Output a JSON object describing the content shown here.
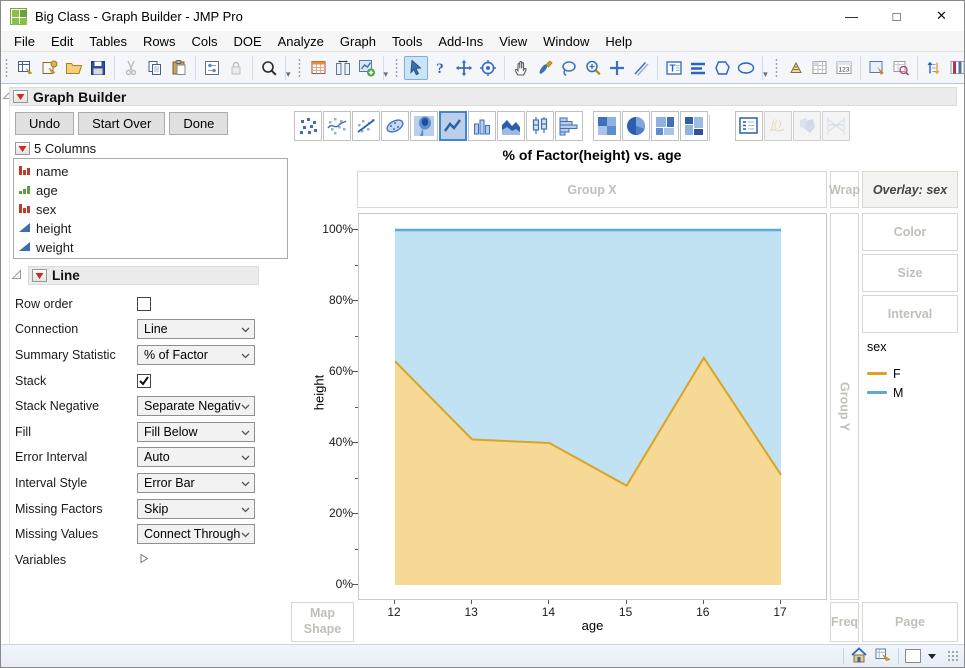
{
  "window": {
    "title": "Big Class - Graph Builder - JMP Pro",
    "controls": [
      {
        "name": "minimize-button",
        "glyph": "—"
      },
      {
        "name": "maximize-button",
        "glyph": "□"
      },
      {
        "name": "close-button",
        "glyph": "✕"
      }
    ]
  },
  "menu": {
    "items": [
      "File",
      "Edit",
      "Tables",
      "Rows",
      "Cols",
      "DOE",
      "Analyze",
      "Graph",
      "Tools",
      "Add-Ins",
      "View",
      "Window",
      "Help"
    ]
  },
  "toolbar": {
    "sections": [
      {
        "groups": [
          {
            "icons": [
              {
                "name": "new-data-table-icon"
              },
              {
                "name": "new-journal-icon"
              },
              {
                "name": "open-icon"
              },
              {
                "name": "save-icon"
              }
            ]
          },
          {
            "icons": [
              {
                "name": "cut-icon",
                "disabled": true
              },
              {
                "name": "copy-icon"
              },
              {
                "name": "paste-icon"
              }
            ]
          },
          {
            "icons": [
              {
                "name": "preferences-icon"
              },
              {
                "name": "lock-icon",
                "disabled": true
              }
            ]
          },
          {
            "icons": [
              {
                "name": "search-icon"
              }
            ]
          }
        ]
      },
      {
        "groups": [
          {
            "icons": [
              {
                "name": "data-table-icon"
              },
              {
                "name": "column-viewer-icon"
              },
              {
                "name": "new-graph-icon"
              }
            ]
          }
        ]
      },
      {
        "groups": [
          {
            "icons": [
              {
                "name": "arrow-cursor-icon",
                "selected": true
              },
              {
                "name": "help-icon"
              },
              {
                "name": "move-tool-icon"
              },
              {
                "name": "selection-target-icon"
              }
            ]
          },
          {
            "icons": [
              {
                "name": "grabber-hand-icon"
              },
              {
                "name": "brush-icon"
              },
              {
                "name": "lasso-icon"
              },
              {
                "name": "magnifier-zoom-icon"
              },
              {
                "name": "crosshair-icon"
              },
              {
                "name": "line-draw-icon"
              }
            ]
          },
          {
            "icons": [
              {
                "name": "text-annotation-icon"
              },
              {
                "name": "thick-lines-icon"
              },
              {
                "name": "polygon-icon"
              },
              {
                "name": "oval-icon"
              }
            ]
          }
        ]
      },
      {
        "groups": [
          {
            "icons": [
              {
                "name": "sort-pyramid-icon"
              },
              {
                "name": "grid-cells-icon"
              },
              {
                "name": "value-labels-icon"
              }
            ]
          },
          {
            "icons": [
              {
                "name": "zoom-window-icon"
              },
              {
                "name": "table-search-icon"
              }
            ]
          },
          {
            "icons": [
              {
                "name": "sort-columns-icon"
              },
              {
                "name": "column-compare-icon"
              },
              {
                "name": "tree-hierarchy-icon"
              }
            ]
          },
          {
            "icons": [
              {
                "name": "calculator-icon"
              },
              {
                "name": "run-script-icon"
              }
            ]
          }
        ]
      }
    ]
  },
  "builder": {
    "title": "Graph Builder",
    "buttons": [
      {
        "label": "Undo"
      },
      {
        "label": "Start Over"
      },
      {
        "label": "Done"
      }
    ],
    "columns_header": "5 Columns",
    "columns": [
      {
        "name": "name",
        "type": "nominal"
      },
      {
        "name": "age",
        "type": "ordinal"
      },
      {
        "name": "sex",
        "type": "nominal"
      },
      {
        "name": "height",
        "type": "continuous"
      },
      {
        "name": "weight",
        "type": "continuous"
      }
    ],
    "section": {
      "title": "Line",
      "options": [
        {
          "label": "Row order",
          "control": "checkbox",
          "checked": false
        },
        {
          "label": "Connection",
          "control": "select",
          "value": "Line"
        },
        {
          "label": "Summary Statistic",
          "control": "select",
          "value": "% of Factor"
        },
        {
          "label": "Stack",
          "control": "checkbox",
          "checked": true
        },
        {
          "label": "Stack Negative",
          "control": "select",
          "value": "Separate Negative"
        },
        {
          "label": "Fill",
          "control": "select",
          "value": "Fill Below"
        },
        {
          "label": "Error Interval",
          "control": "select",
          "value": "Auto"
        },
        {
          "label": "Interval Style",
          "control": "select",
          "value": "Error Bar"
        },
        {
          "label": "Missing Factors",
          "control": "select",
          "value": "Skip"
        },
        {
          "label": "Missing Values",
          "control": "select",
          "value": "Connect Through"
        },
        {
          "label": "Variables",
          "control": "disclosure"
        }
      ]
    }
  },
  "element_palette": [
    {
      "name": "points-element-icon"
    },
    {
      "name": "smoother-element-icon"
    },
    {
      "name": "line-of-fit-element-icon"
    },
    {
      "name": "ellipse-element-icon"
    },
    {
      "name": "contour-element-icon"
    },
    {
      "name": "line-element-icon",
      "selected": true
    },
    {
      "name": "bar-element-icon"
    },
    {
      "name": "area-element-icon"
    },
    {
      "name": "box-plot-element-icon"
    },
    {
      "name": "histogram-element-icon"
    },
    {
      "name": "heatmap-element-icon",
      "gap_before": true
    },
    {
      "name": "pie-element-icon"
    },
    {
      "name": "treemap-element-icon"
    },
    {
      "name": "mosaic-element-icon"
    },
    {
      "name": "caption-box-element-icon",
      "bigGap_before": true
    },
    {
      "name": "formula-element-icon",
      "disabled": true
    },
    {
      "name": "map-shapes-element-icon",
      "disabled": true
    },
    {
      "name": "parallel-element-icon",
      "disabled": true
    }
  ],
  "graph": {
    "title": "% of Factor(height) vs. age",
    "zones": {
      "group_x": "Group X",
      "wrap": "Wrap",
      "overlay": "Overlay: sex",
      "group_y": "Group Y",
      "color": "Color",
      "size": "Size",
      "interval": "Interval",
      "map_shape": "Map\nShape",
      "freq": "Freq",
      "page": "Page"
    },
    "legend": {
      "title": "sex",
      "entries": [
        {
          "label": "F",
          "color": "#d9a428"
        },
        {
          "label": "M",
          "color": "#58abdc"
        }
      ]
    }
  },
  "chart_data": {
    "type": "area",
    "stacked": true,
    "title": "% of Factor(height) vs. age",
    "x": [
      12,
      13,
      14,
      15,
      16,
      17
    ],
    "xlabel": "age",
    "ylabel": "height",
    "ylim": [
      0,
      100
    ],
    "y_ticks": [
      {
        "value": 0,
        "label": "0%"
      },
      {
        "value": 20,
        "label": "20%"
      },
      {
        "value": 40,
        "label": "40%"
      },
      {
        "value": 60,
        "label": "60%"
      },
      {
        "value": 80,
        "label": "80%"
      },
      {
        "value": 100,
        "label": "100%"
      }
    ],
    "y_minor_ticks": [
      10,
      30,
      50,
      70,
      90
    ],
    "grid": false,
    "legend_position": "right",
    "series": [
      {
        "name": "F",
        "values": [
          63,
          41,
          40,
          28,
          64,
          31
        ],
        "line_color": "#d9a428",
        "fill_color": "#f5d995"
      },
      {
        "name": "M",
        "values": [
          37,
          59,
          60,
          72,
          36,
          69
        ],
        "line_color": "#58abdc",
        "fill_color": "#c1e2f3"
      }
    ]
  },
  "statusbar": {
    "icons": [
      {
        "name": "home-window-icon"
      },
      {
        "name": "table-script-icon"
      }
    ]
  }
}
